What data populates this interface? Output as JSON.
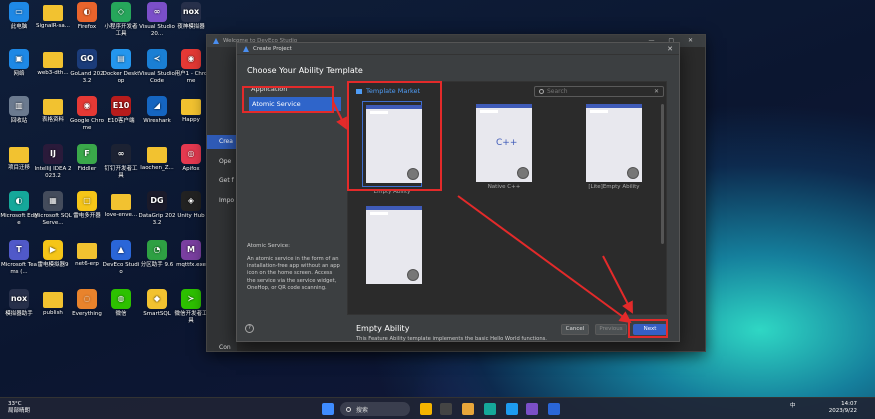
{
  "desktop": {
    "icons": [
      {
        "label": "此电脑",
        "color": "#1e88e5",
        "glyph": "▭"
      },
      {
        "label": "SignalR-sa...",
        "color": "#f2c230",
        "glyph": ""
      },
      {
        "label": "Firefox",
        "color": "#e8642c",
        "glyph": "◐"
      },
      {
        "label": "小程序开发者工具",
        "color": "#26a65b",
        "glyph": "◇"
      },
      {
        "label": "Visual Studio 20...",
        "color": "#7b4fc8",
        "glyph": "∞"
      },
      {
        "label": "夜神模拟器",
        "color": "#27304a",
        "glyph": "nox"
      },
      {
        "label": "网络",
        "color": "#1e88e5",
        "glyph": "▣"
      },
      {
        "label": "web3-dth...",
        "color": "#f2c230",
        "glyph": ""
      },
      {
        "label": "GoLand 2023.2",
        "color": "#1b3c7a",
        "glyph": "GO"
      },
      {
        "label": "Docker Desktop",
        "color": "#2496ed",
        "glyph": "▤"
      },
      {
        "label": "Visual Studio Code",
        "color": "#1a7fd4",
        "glyph": "≺"
      },
      {
        "label": "用户1 - Chrome",
        "color": "#e53935",
        "glyph": "◉"
      },
      {
        "label": "回收站",
        "color": "#6b7a8f",
        "glyph": "▥"
      },
      {
        "label": "表格资料",
        "color": "#f2c230",
        "glyph": ""
      },
      {
        "label": "Google Chrome",
        "color": "#e53935",
        "glyph": "◉"
      },
      {
        "label": "E10客户端",
        "color": "#b71c1c",
        "glyph": "E10"
      },
      {
        "label": "Wireshark",
        "color": "#1565c0",
        "glyph": "◢"
      },
      {
        "label": "Happy",
        "color": "#f2c230",
        "glyph": ""
      },
      {
        "label": "项目迁移",
        "color": "#f2c230",
        "glyph": ""
      },
      {
        "label": "IntelliJ IDEA 2023.2",
        "color": "#2a1a3a",
        "glyph": "IJ"
      },
      {
        "label": "Fiddler",
        "color": "#3aa84a",
        "glyph": "F"
      },
      {
        "label": "钉钉开发者工具",
        "color": "#1c2233",
        "glyph": "∞"
      },
      {
        "label": "laochen_Z...",
        "color": "#f2c230",
        "glyph": ""
      },
      {
        "label": "Apifox",
        "color": "#e53950",
        "glyph": "◎"
      },
      {
        "label": "Microsoft Edge",
        "color": "#15a89a",
        "glyph": "◐"
      },
      {
        "label": "Microsoft SQL Serve...",
        "color": "#444c5c",
        "glyph": "▦"
      },
      {
        "label": "雷电多开器",
        "color": "#f5c518",
        "glyph": "▢"
      },
      {
        "label": "love-enve...",
        "color": "#f2c230",
        "glyph": ""
      },
      {
        "label": "DataGrip 2023.2",
        "color": "#1a1a2a",
        "glyph": "DG"
      },
      {
        "label": "Unity Hub",
        "color": "#222",
        "glyph": "◈"
      },
      {
        "label": "Microsoft Teams (...",
        "color": "#5059c9",
        "glyph": "T"
      },
      {
        "label": "雷电模拟器9",
        "color": "#f5c518",
        "glyph": "▶"
      },
      {
        "label": "net6-erp",
        "color": "#f2c230",
        "glyph": ""
      },
      {
        "label": "DevEco Studio",
        "color": "#2a66d8",
        "glyph": "▲"
      },
      {
        "label": "分区助手 9.6",
        "color": "#2ea043",
        "glyph": "◔"
      },
      {
        "label": "mqttfx.exe",
        "color": "#7a3fa0",
        "glyph": "M"
      },
      {
        "label": "模拟器助手",
        "color": "#27304a",
        "glyph": "nox"
      },
      {
        "label": "publish",
        "color": "#f2c230",
        "glyph": ""
      },
      {
        "label": "Everything",
        "color": "#e8832c",
        "glyph": "◌"
      },
      {
        "label": "微信",
        "color": "#2dc100",
        "glyph": "◍"
      },
      {
        "label": "SmartSQL",
        "color": "#f2c230",
        "glyph": "◆"
      },
      {
        "label": "微信开发者工具",
        "color": "#2dc100",
        "glyph": "≻"
      }
    ]
  },
  "deveco": {
    "title": "Welcome to DevEco Studio",
    "controls": "— ▢ ✕",
    "side_items": [
      "Crea",
      "Ope",
      "Get f",
      "Impo",
      "Con"
    ]
  },
  "dialog": {
    "title": "Create Project",
    "close": "✕",
    "heading": "Choose Your Ability Template",
    "category_label": "Application",
    "category_selected": "Atomic Service",
    "desc_title": "Atomic Service:",
    "description": "An atomic service in the form of an installation-free app without an app icon on the home screen. Access the service via the service widget, OneHop, or QR code scanning.",
    "help": "?",
    "market": "Template Market",
    "search_placeholder": "Search",
    "search_clear": "✕",
    "templates": [
      {
        "name": "Empty Ability",
        "cpp": ""
      },
      {
        "name": "Native C++",
        "cpp": "C++"
      },
      {
        "name": "[Lite]Empty Ability",
        "cpp": ""
      },
      {
        "name": "",
        "cpp": ""
      }
    ],
    "detail_title": "Empty Ability",
    "detail_desc": "This Feature Ability template implements the basic Hello World functions.",
    "buttons": {
      "cancel": "Cancel",
      "previous": "Previous",
      "next": "Next"
    }
  },
  "taskbar": {
    "temp": "33°C",
    "weather": "局部晴朗",
    "search": "搜索",
    "ime": "中",
    "time": "14:07",
    "date": "2023/9/22"
  }
}
